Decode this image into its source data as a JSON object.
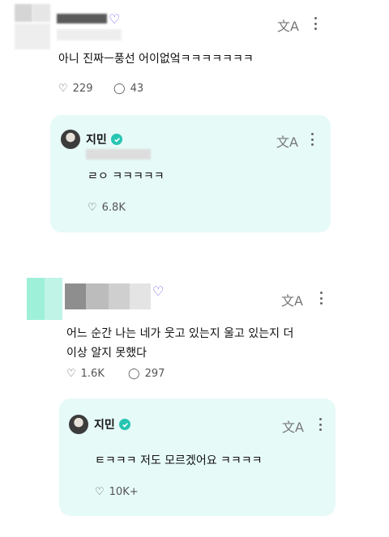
{
  "comments": [
    {
      "text": "아니 진짜ㅡ풍선 어이없엌ㅋㅋㅋㅋㅋㅋㅋ",
      "likes": "229",
      "replies": "43",
      "reply": {
        "artist": "지민",
        "text": "ㄹㅇ ㅋㅋㅋㅋㅋ",
        "likes": "6.8K"
      }
    },
    {
      "text_line1": "어느 순간 나는 네가 웃고 있는지 울고 있는지 더",
      "text_line2": "이상 알지 못했다",
      "likes": "1.6K",
      "replies": "297",
      "reply": {
        "artist": "지민",
        "text": "ㅌㅋㅋㅋ 저도 모르겠어요 ㅋㅋㅋㅋ",
        "likes": "10K+"
      }
    }
  ],
  "icons": {
    "translate": "translate-icon",
    "more": "more-vertical-icon",
    "like": "heart-hands-icon",
    "reply": "comment-bubble-icon",
    "verified": "verified-badge-icon"
  },
  "colors": {
    "reply_bg": "#e6faf8",
    "verified": "#27c5b2",
    "badge_purple": "#7a5cf0",
    "badge_teal": "#3dd6c4"
  }
}
